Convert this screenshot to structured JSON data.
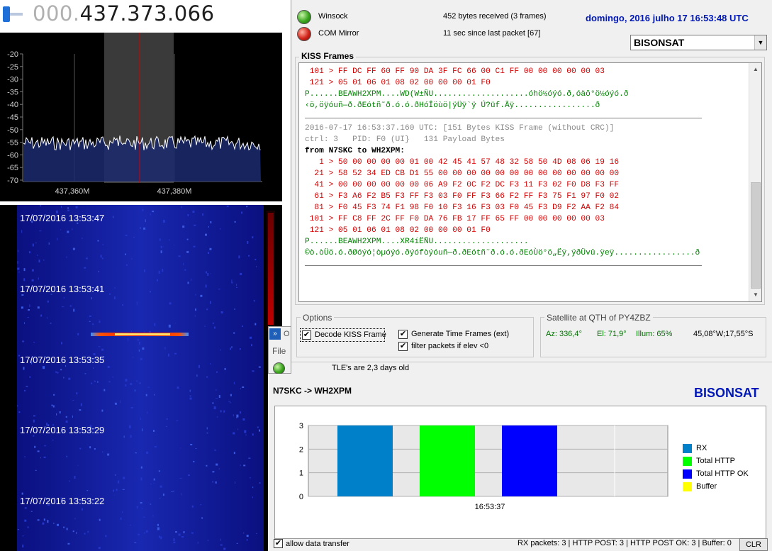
{
  "sdr": {
    "frequency_dim": "000.",
    "frequency_main": "437.373.066",
    "db_ticks": [
      "-20",
      "-25",
      "-30",
      "-35",
      "-40",
      "-45",
      "-50",
      "-55",
      "-60",
      "-65",
      "-70"
    ],
    "freq_ticks": [
      "437,360M",
      "437,380M"
    ],
    "waterfall_times": [
      "17/07/2016 13:53:47",
      "17/07/2016 13:53:41",
      "17/07/2016 13:53:35",
      "17/07/2016 13:53:29",
      "17/07/2016 13:53:22"
    ]
  },
  "small_window": {
    "label_o": "O",
    "label_file": "File"
  },
  "status": {
    "winsock_label": "Winsock",
    "com_label": "COM Mirror",
    "bytes_received": "452 bytes received (3 frames)",
    "since_last": "11 sec since last packet [67]",
    "datetime": "domingo, 2016 julho 17  16:53:48 UTC",
    "satellite_selected": "BISONSAT"
  },
  "kiss": {
    "title": "KISS Frames",
    "lines": [
      {
        "cls": "l-red",
        "text": " 101 > FF DC FF 60 FF 90 DA 3F FC 66 00 C1 FF 00 00 00 00 00 03"
      },
      {
        "cls": "l-red",
        "text": " 121 > 05 01 06 01 08 02 00 00 00 01 F0"
      },
      {
        "cls": "l-green",
        "text": "P......BEAWH2XPM....WD(W±ÑU....................óhö½óýó.ð,óäö°ö½óýó.ð"
      },
      {
        "cls": "l-green",
        "text": "‹ö,öÿóuñ—ð.ðEótñ˜ð.ó.ó.ðHóÎöùö|ÿÜÿ`ÿ Ú?üf.Ãÿ.................ð"
      },
      {
        "cls": "l-sep",
        "text": ""
      },
      {
        "cls": "l-black",
        "text": ""
      },
      {
        "cls": "l-gray",
        "text": "2016-07-17 16:53:37.160 UTC: [151 Bytes KISS Frame (without CRC)]"
      },
      {
        "cls": "l-gray",
        "text": "ctrl: 3   PID: F0 (UI}   131 Payload Bytes"
      },
      {
        "cls": "l-black",
        "text": "from N7SKC to WH2XPM:"
      },
      {
        "cls": "l-red",
        "text": "   1 > 50 00 00 00 00 01 00 42 45 41 57 48 32 58 50 4D 08 06 19 16"
      },
      {
        "cls": "l-red",
        "text": "  21 > 58 52 34 ED CB D1 55 00 00 00 00 00 00 00 00 00 00 00 00 00"
      },
      {
        "cls": "l-red",
        "text": "  41 > 00 00 00 00 00 00 06 A9 F2 0C F2 DC F3 11 F3 02 F0 D8 F3 FF"
      },
      {
        "cls": "l-red",
        "text": "  61 > F3 A6 F2 B5 F3 FF F3 03 F0 FF F3 66 F2 FF F3 75 F1 97 F0 02"
      },
      {
        "cls": "l-red",
        "text": "  81 > F0 45 F3 74 F1 98 F0 10 F3 16 F3 03 F0 45 F3 D9 F2 AA F2 84"
      },
      {
        "cls": "l-red",
        "text": " 101 > FF C8 FF 2C FF F0 DA 76 FB 17 FF 65 FF 00 00 00 00 00 03"
      },
      {
        "cls": "l-red",
        "text": " 121 > 05 01 06 01 08 02 00 00 00 01 F0"
      },
      {
        "cls": "l-green",
        "text": "P......BEAWH2XPM....XR4íËÑU...................."
      },
      {
        "cls": "l-green",
        "text": "©ò.òÜö.ó.ðØóýó¦òµóýó.ðýófòýóuñ—ð.ðEótñ˜ð.ó.ó.ðEóÙö°ö„Ëÿ,ÿðÜvû.ÿeÿ.................ð"
      },
      {
        "cls": "l-sep",
        "text": ""
      }
    ]
  },
  "options": {
    "title": "Options",
    "decode_label": "Decode KISS Frame",
    "gen_time_label": "Generate Time Frames (ext)",
    "filter_label": "filter packets if elev <0",
    "check_mark": "✔"
  },
  "satellite": {
    "title": "Satellite at QTH of PY4ZBZ",
    "az": "Az: 336,4°",
    "el": "El: 71,9°",
    "illum": "Illum: 65%",
    "position": "45,08°W;17,55°S"
  },
  "tle_status": "TLE's are 2,3 days old",
  "bottom": {
    "route": "N7SKC -> WH2XPM",
    "satellite": "BISONSAT",
    "allow_label": "allow data transfer",
    "counters": "RX packets: 3 | HTTP POST: 3 | HTTP POST OK: 3 | Buffer: 0",
    "clr_label": "CLR"
  },
  "chart_data": {
    "type": "bar",
    "categories": [
      "16:53:37"
    ],
    "series": [
      {
        "name": "RX",
        "values": [
          3
        ],
        "color": "#0080c8"
      },
      {
        "name": "Total HTTP",
        "values": [
          3
        ],
        "color": "#00ff00"
      },
      {
        "name": "Total HTTP OK",
        "values": [
          3
        ],
        "color": "#0000ff"
      },
      {
        "name": "Buffer",
        "values": [
          0
        ],
        "color": "#ffff00"
      }
    ],
    "ylim": [
      0,
      3
    ],
    "yticks": [
      "0",
      "1",
      "2",
      "3"
    ],
    "grid": true,
    "legend": "right"
  }
}
